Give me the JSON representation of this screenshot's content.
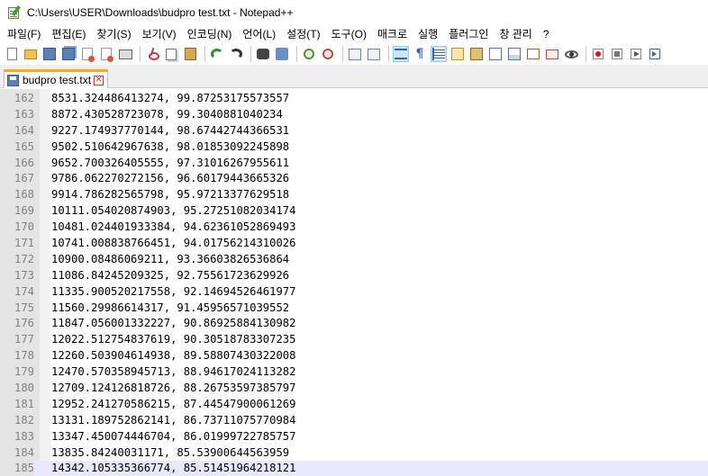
{
  "window": {
    "title": "C:\\Users\\USER\\Downloads\\budpro test.txt - Notepad++"
  },
  "menu": [
    "파일(F)",
    "편집(E)",
    "찾기(S)",
    "보기(V)",
    "인코딩(N)",
    "언어(L)",
    "설정(T)",
    "도구(O)",
    "매크로",
    "실행",
    "플러그인",
    "창 관리",
    "?"
  ],
  "tab": {
    "label": "budpro test.txt",
    "close_glyph": "✕"
  },
  "toolbar": {
    "paragraph_glyph": "¶"
  },
  "lines": [
    {
      "n": "162",
      "text": "8531.324486413274, 99.87253175573557"
    },
    {
      "n": "163",
      "text": "8872.430528723078, 99.3040881040234"
    },
    {
      "n": "164",
      "text": "9227.174937770144, 98.67442744366531"
    },
    {
      "n": "165",
      "text": "9502.510642967638, 98.01853092245898"
    },
    {
      "n": "166",
      "text": "9652.700326405555, 97.31016267955611"
    },
    {
      "n": "167",
      "text": "9786.062270272156, 96.60179443665326"
    },
    {
      "n": "168",
      "text": "9914.786282565798, 95.97213377629518"
    },
    {
      "n": "169",
      "text": "10111.054020874903, 95.27251082034174"
    },
    {
      "n": "170",
      "text": "10481.024401933384, 94.62361052869493"
    },
    {
      "n": "171",
      "text": "10741.008838766451, 94.01756214310026"
    },
    {
      "n": "172",
      "text": "10900.08486069211, 93.36603826536864"
    },
    {
      "n": "173",
      "text": "11086.84245209325, 92.75561723629926"
    },
    {
      "n": "174",
      "text": "11335.900520217558, 92.14694526461977"
    },
    {
      "n": "175",
      "text": "11560.29986614317, 91.45956571039552"
    },
    {
      "n": "176",
      "text": "11847.056001332227, 90.86925884130982"
    },
    {
      "n": "177",
      "text": "12022.512754837619, 90.30518783307235"
    },
    {
      "n": "178",
      "text": "12260.503904614938, 89.58807430322008"
    },
    {
      "n": "179",
      "text": "12470.570358945713, 88.94617024113282"
    },
    {
      "n": "180",
      "text": "12709.124126818726, 88.26753597385797"
    },
    {
      "n": "181",
      "text": "12952.241270586215, 87.44547900061269"
    },
    {
      "n": "182",
      "text": "13131.189752862141, 86.73711075770984"
    },
    {
      "n": "183",
      "text": "13347.450074446704, 86.01999722785757"
    },
    {
      "n": "184",
      "text": "13835.84240031171, 85.53900644563959"
    },
    {
      "n": "185",
      "text": "14342.105335366774, 85.51451964218121"
    }
  ],
  "current_line": "185",
  "colors": {
    "tab_accent": "#fba919",
    "current_line_bg": "#e8e8ff",
    "gutter_bg": "#e4e4e4",
    "line_number": "#808080"
  }
}
